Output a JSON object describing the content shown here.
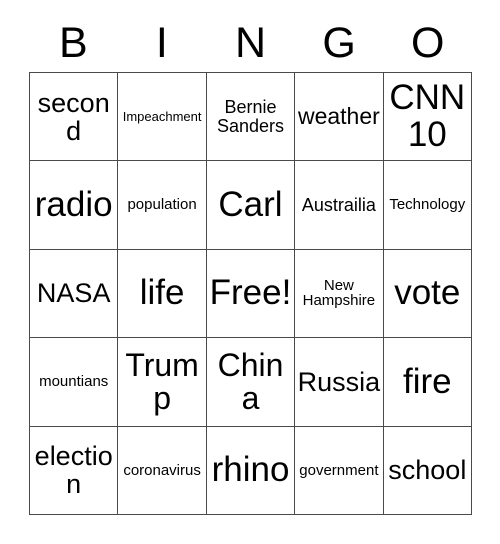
{
  "card": {
    "title": "BINGO",
    "header_letters": [
      "B",
      "I",
      "N",
      "G",
      "O"
    ],
    "columns": 5,
    "rows": 5,
    "free_space_label": "Free!",
    "colors": {
      "background": "#ffffff",
      "text": "#000000",
      "grid_line": "#4a4a4a"
    },
    "cells": [
      [
        {
          "label": "second",
          "size": "lg"
        },
        {
          "label": "Impeachment",
          "size": "xxs"
        },
        {
          "label": "Bernie Sanders",
          "size": "sm"
        },
        {
          "label": "weather",
          "size": "md"
        },
        {
          "label": "CNN 10",
          "size": "xxl"
        }
      ],
      [
        {
          "label": "radio",
          "size": "xxl"
        },
        {
          "label": "population",
          "size": "xs"
        },
        {
          "label": "Carl",
          "size": "xxl"
        },
        {
          "label": "Austrailia",
          "size": "sm"
        },
        {
          "label": "Technology",
          "size": "xs"
        }
      ],
      [
        {
          "label": "NASA",
          "size": "lg"
        },
        {
          "label": "life",
          "size": "xxl"
        },
        {
          "label": "Free!",
          "size": "xxl"
        },
        {
          "label": "New Hampshire",
          "size": "xs"
        },
        {
          "label": "vote",
          "size": "xxl"
        }
      ],
      [
        {
          "label": "mountians",
          "size": "xs"
        },
        {
          "label": "Trump",
          "size": "xl"
        },
        {
          "label": "China",
          "size": "xl"
        },
        {
          "label": "Russia",
          "size": "lg"
        },
        {
          "label": "fire",
          "size": "xxl"
        }
      ],
      [
        {
          "label": "election",
          "size": "lg"
        },
        {
          "label": "coronavirus",
          "size": "xs"
        },
        {
          "label": "rhino",
          "size": "xxl"
        },
        {
          "label": "government",
          "size": "xs"
        },
        {
          "label": "school",
          "size": "lg"
        }
      ]
    ]
  }
}
